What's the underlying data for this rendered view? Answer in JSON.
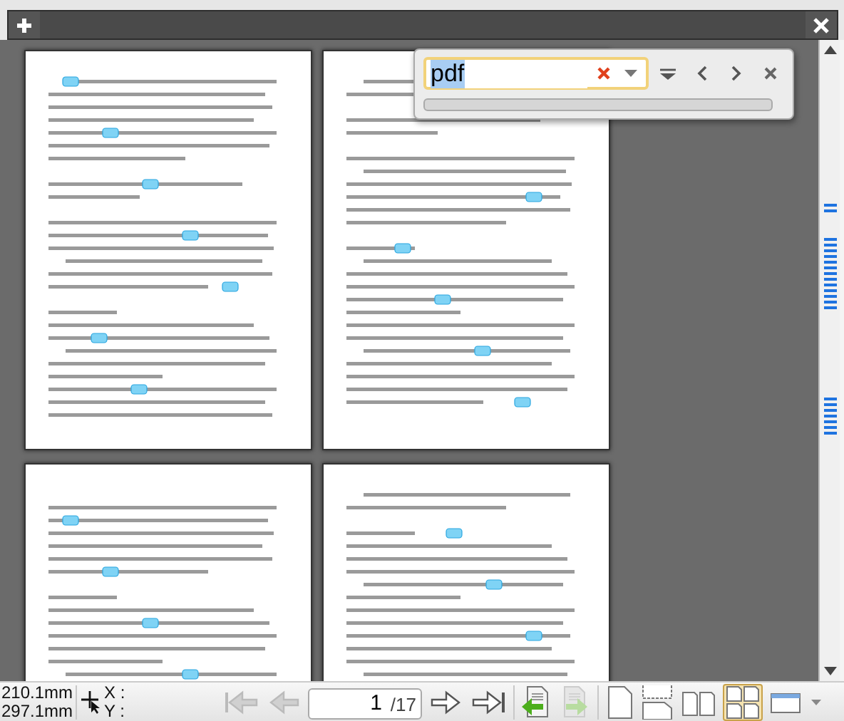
{
  "find_bar": {
    "query": "pdf",
    "query_selected": true,
    "progress": {
      "level": 0
    }
  },
  "status": {
    "page_width": "210.1mm",
    "page_height": "297.1mm",
    "x_label": "X :",
    "y_label": "Y :"
  },
  "page_field": {
    "page": "1",
    "page_count": "/17"
  },
  "nav_buttons": [
    {
      "kind": "first",
      "disabled": true
    },
    {
      "kind": "prev",
      "disabled": true
    },
    {
      "kind": "next",
      "disabled": false
    },
    {
      "kind": "last",
      "disabled": false
    }
  ],
  "document_buttons": [
    {
      "kind": "prev-document",
      "disabled": false
    },
    {
      "kind": "next-document",
      "disabled": true
    }
  ],
  "view_modes": [
    {
      "kind": "single",
      "selected": false
    },
    {
      "kind": "continuous",
      "selected": false
    },
    {
      "kind": "facing",
      "selected": false
    },
    {
      "kind": "grid",
      "selected": true
    },
    {
      "kind": "window",
      "selected": false
    }
  ]
}
